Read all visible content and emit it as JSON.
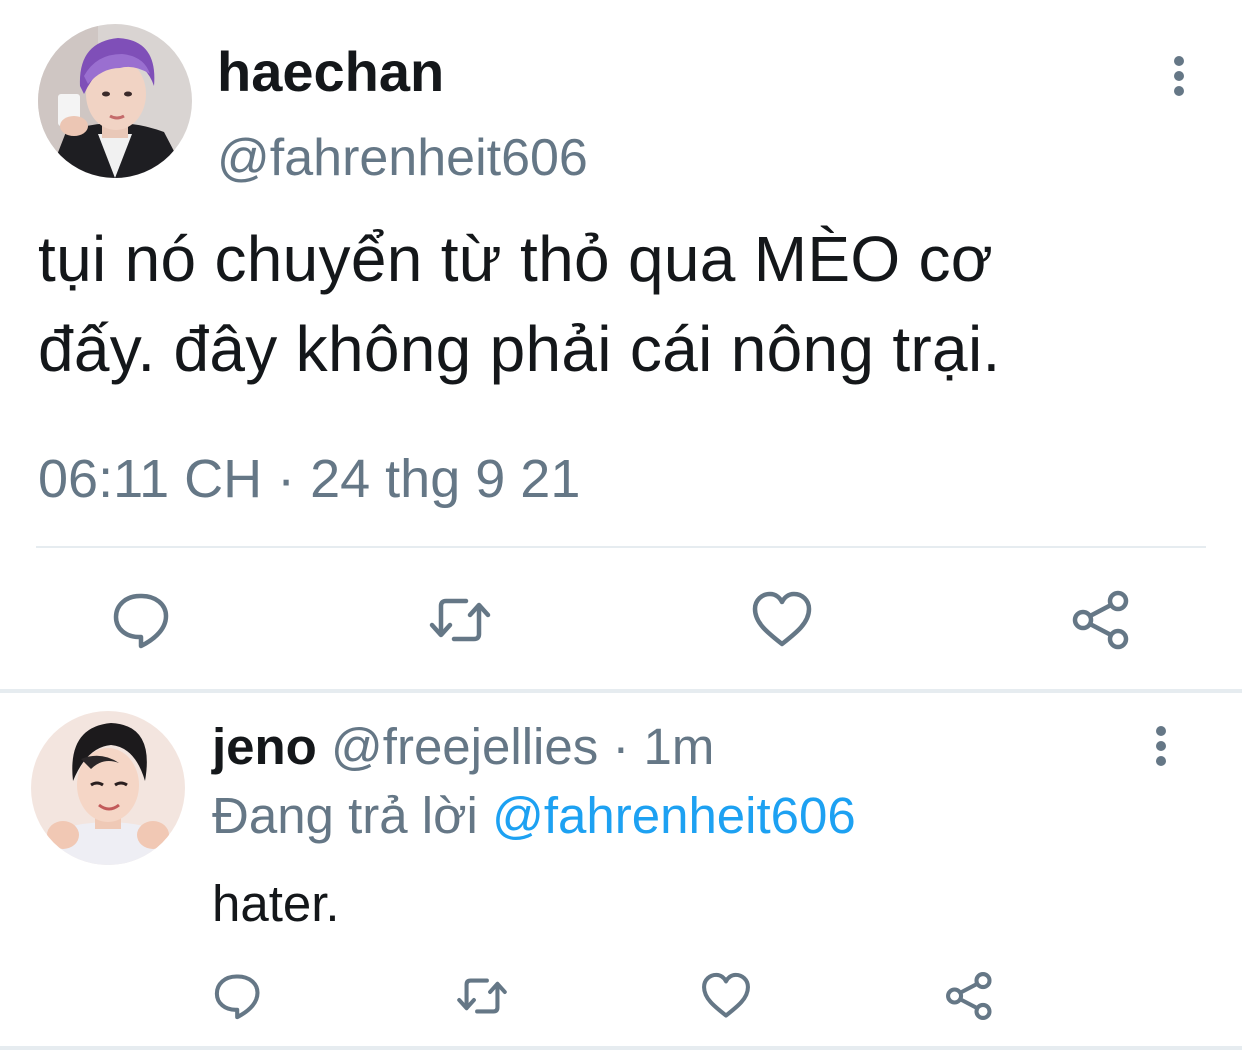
{
  "main_tweet": {
    "author": {
      "display_name": "haechan",
      "handle": "@fahrenheit606",
      "avatar": "avatar-photo"
    },
    "text_lines": [
      "tụi nó chuyển từ thỏ qua MÈO cơ",
      "đấy. đây không phải cái nông trại."
    ],
    "timestamp": "06:11 CH · 24 thg 9 21",
    "actions": [
      "reply-icon",
      "retweet-icon",
      "like-icon",
      "share-icon"
    ],
    "more_icon": "more-vertical-icon"
  },
  "reply_tweet": {
    "author": {
      "display_name": "jeno",
      "handle": "@freejellies",
      "time_separator": " · ",
      "relative_time": "1m",
      "avatar": "avatar-photo"
    },
    "replying_to_label": "Đang trả lời",
    "replying_to_handle": "@fahrenheit606",
    "text": "hater.",
    "actions": [
      "reply-icon",
      "retweet-icon",
      "like-icon",
      "share-icon"
    ],
    "more_icon": "more-vertical-icon"
  },
  "colors": {
    "text_primary": "#14171a",
    "text_secondary": "#657786",
    "link": "#1da1f2",
    "divider": "#e6ecf0"
  }
}
